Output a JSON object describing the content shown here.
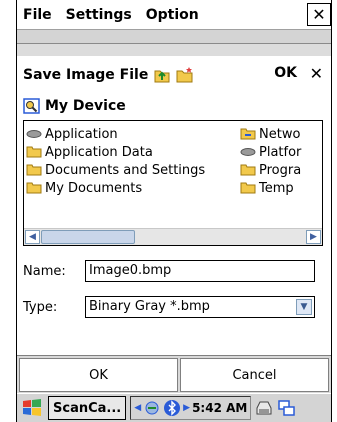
{
  "menubar": {
    "items": [
      "File",
      "Settings",
      "Option"
    ],
    "close_glyph": "✕"
  },
  "dialog": {
    "title": "Save Image File",
    "ok_label": "OK",
    "close_glyph": "✕",
    "location": "My Device",
    "files_col1": [
      "Application",
      "Application Data",
      "Documents and Settings",
      "My Documents"
    ],
    "files_col2": [
      "Netwo",
      "Platfor",
      "Progra",
      "Temp"
    ],
    "name_label": "Name:",
    "name_value": "Image0.bmp",
    "type_label": "Type:",
    "type_value": "Binary Gray *.bmp"
  },
  "buttons": {
    "ok": "OK",
    "cancel": "Cancel"
  },
  "taskbar": {
    "task": "ScanCa...",
    "time": "5:42 AM"
  },
  "colors": {
    "folder": "#f2c94c",
    "accent_blue": "#2a5bd7",
    "scroll": "#7f9db9"
  }
}
